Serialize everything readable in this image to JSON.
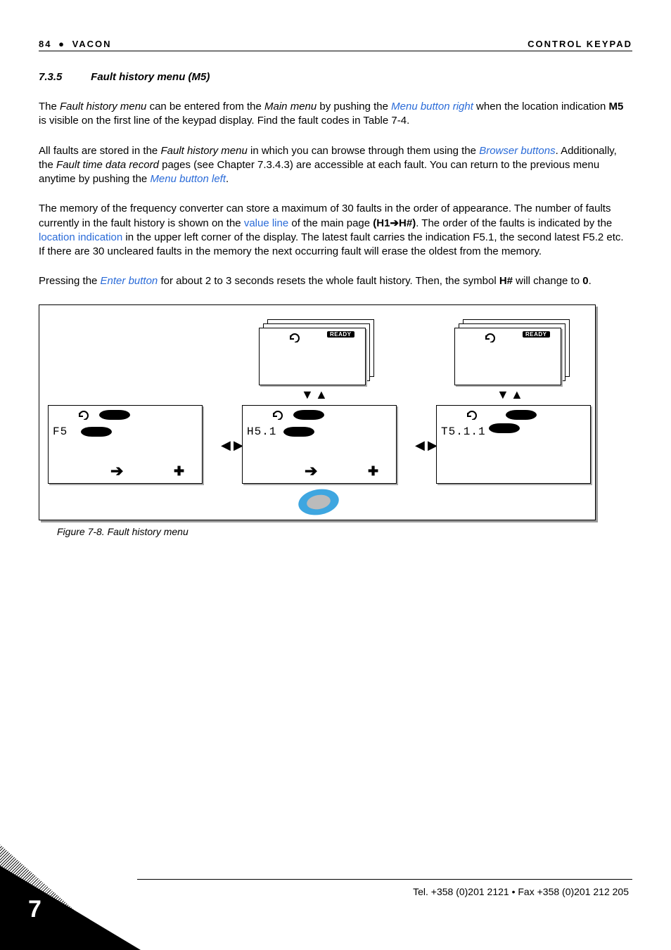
{
  "header": {
    "page_number_top": "84",
    "brand": "VACON",
    "section_right": "CONTROL KEYPAD"
  },
  "section": {
    "number": "7.3.5",
    "title": "Fault history menu (M5)"
  },
  "para1": {
    "t1": "The ",
    "i1": "Fault history menu",
    "t2": " can be entered from the ",
    "i2": "Main menu",
    "t3": " by pushing the ",
    "link1": "Menu button right",
    "t4": " when the location indication ",
    "b1": "M5",
    "t5": " is visible on the first line of the keypad display. Find the fault codes in Table 7-4."
  },
  "para2": {
    "t1": "All faults are stored in the ",
    "i1": "Fault history menu",
    "t2": " in which you can browse through them using the ",
    "link1": "Browser buttons",
    "t3": ". Additionally, the ",
    "i2": "Fault time data record",
    "t4": " pages (see Chapter 7.3.4.3) are accessible at each fault. You can return to the previous menu anytime by pushing the ",
    "link2": "Menu button left",
    "t5": "."
  },
  "para3": {
    "t1": "The memory of the frequency converter can store a maximum of 30 faults in the order of appearance. The number of faults currently in the fault history is shown on the ",
    "link1": "value line",
    "t2": " of the main page ",
    "b1": "(H1",
    "arrow": "➔",
    "b2": "H#)",
    "t3": ". The order of the faults is indicated by the ",
    "link2": "location indication",
    "t4": " in the upper left corner of the display. The latest fault carries the indication F5.1, the second latest F5.2 etc. If there are 30 uncleared faults in the memory the next occurring fault will erase the oldest from the memory."
  },
  "para4": {
    "t1": "Pressing the ",
    "link1": "Enter button",
    "t2": " for about 2 to 3 seconds resets the whole fault history. Then, the symbol ",
    "b1": "H#",
    "t3": " will change to ",
    "b2": "0",
    "t4": "."
  },
  "figure": {
    "caption": "Figure 7-8. Fault history menu",
    "ready": "READY",
    "screen1_label": "F5",
    "screen2_label": "H5.1",
    "screen3_label": "T5.1.1"
  },
  "footer": {
    "chapter": "7",
    "contact": "Tel. +358 (0)201 2121 • Fax +358 (0)201 212 205"
  }
}
